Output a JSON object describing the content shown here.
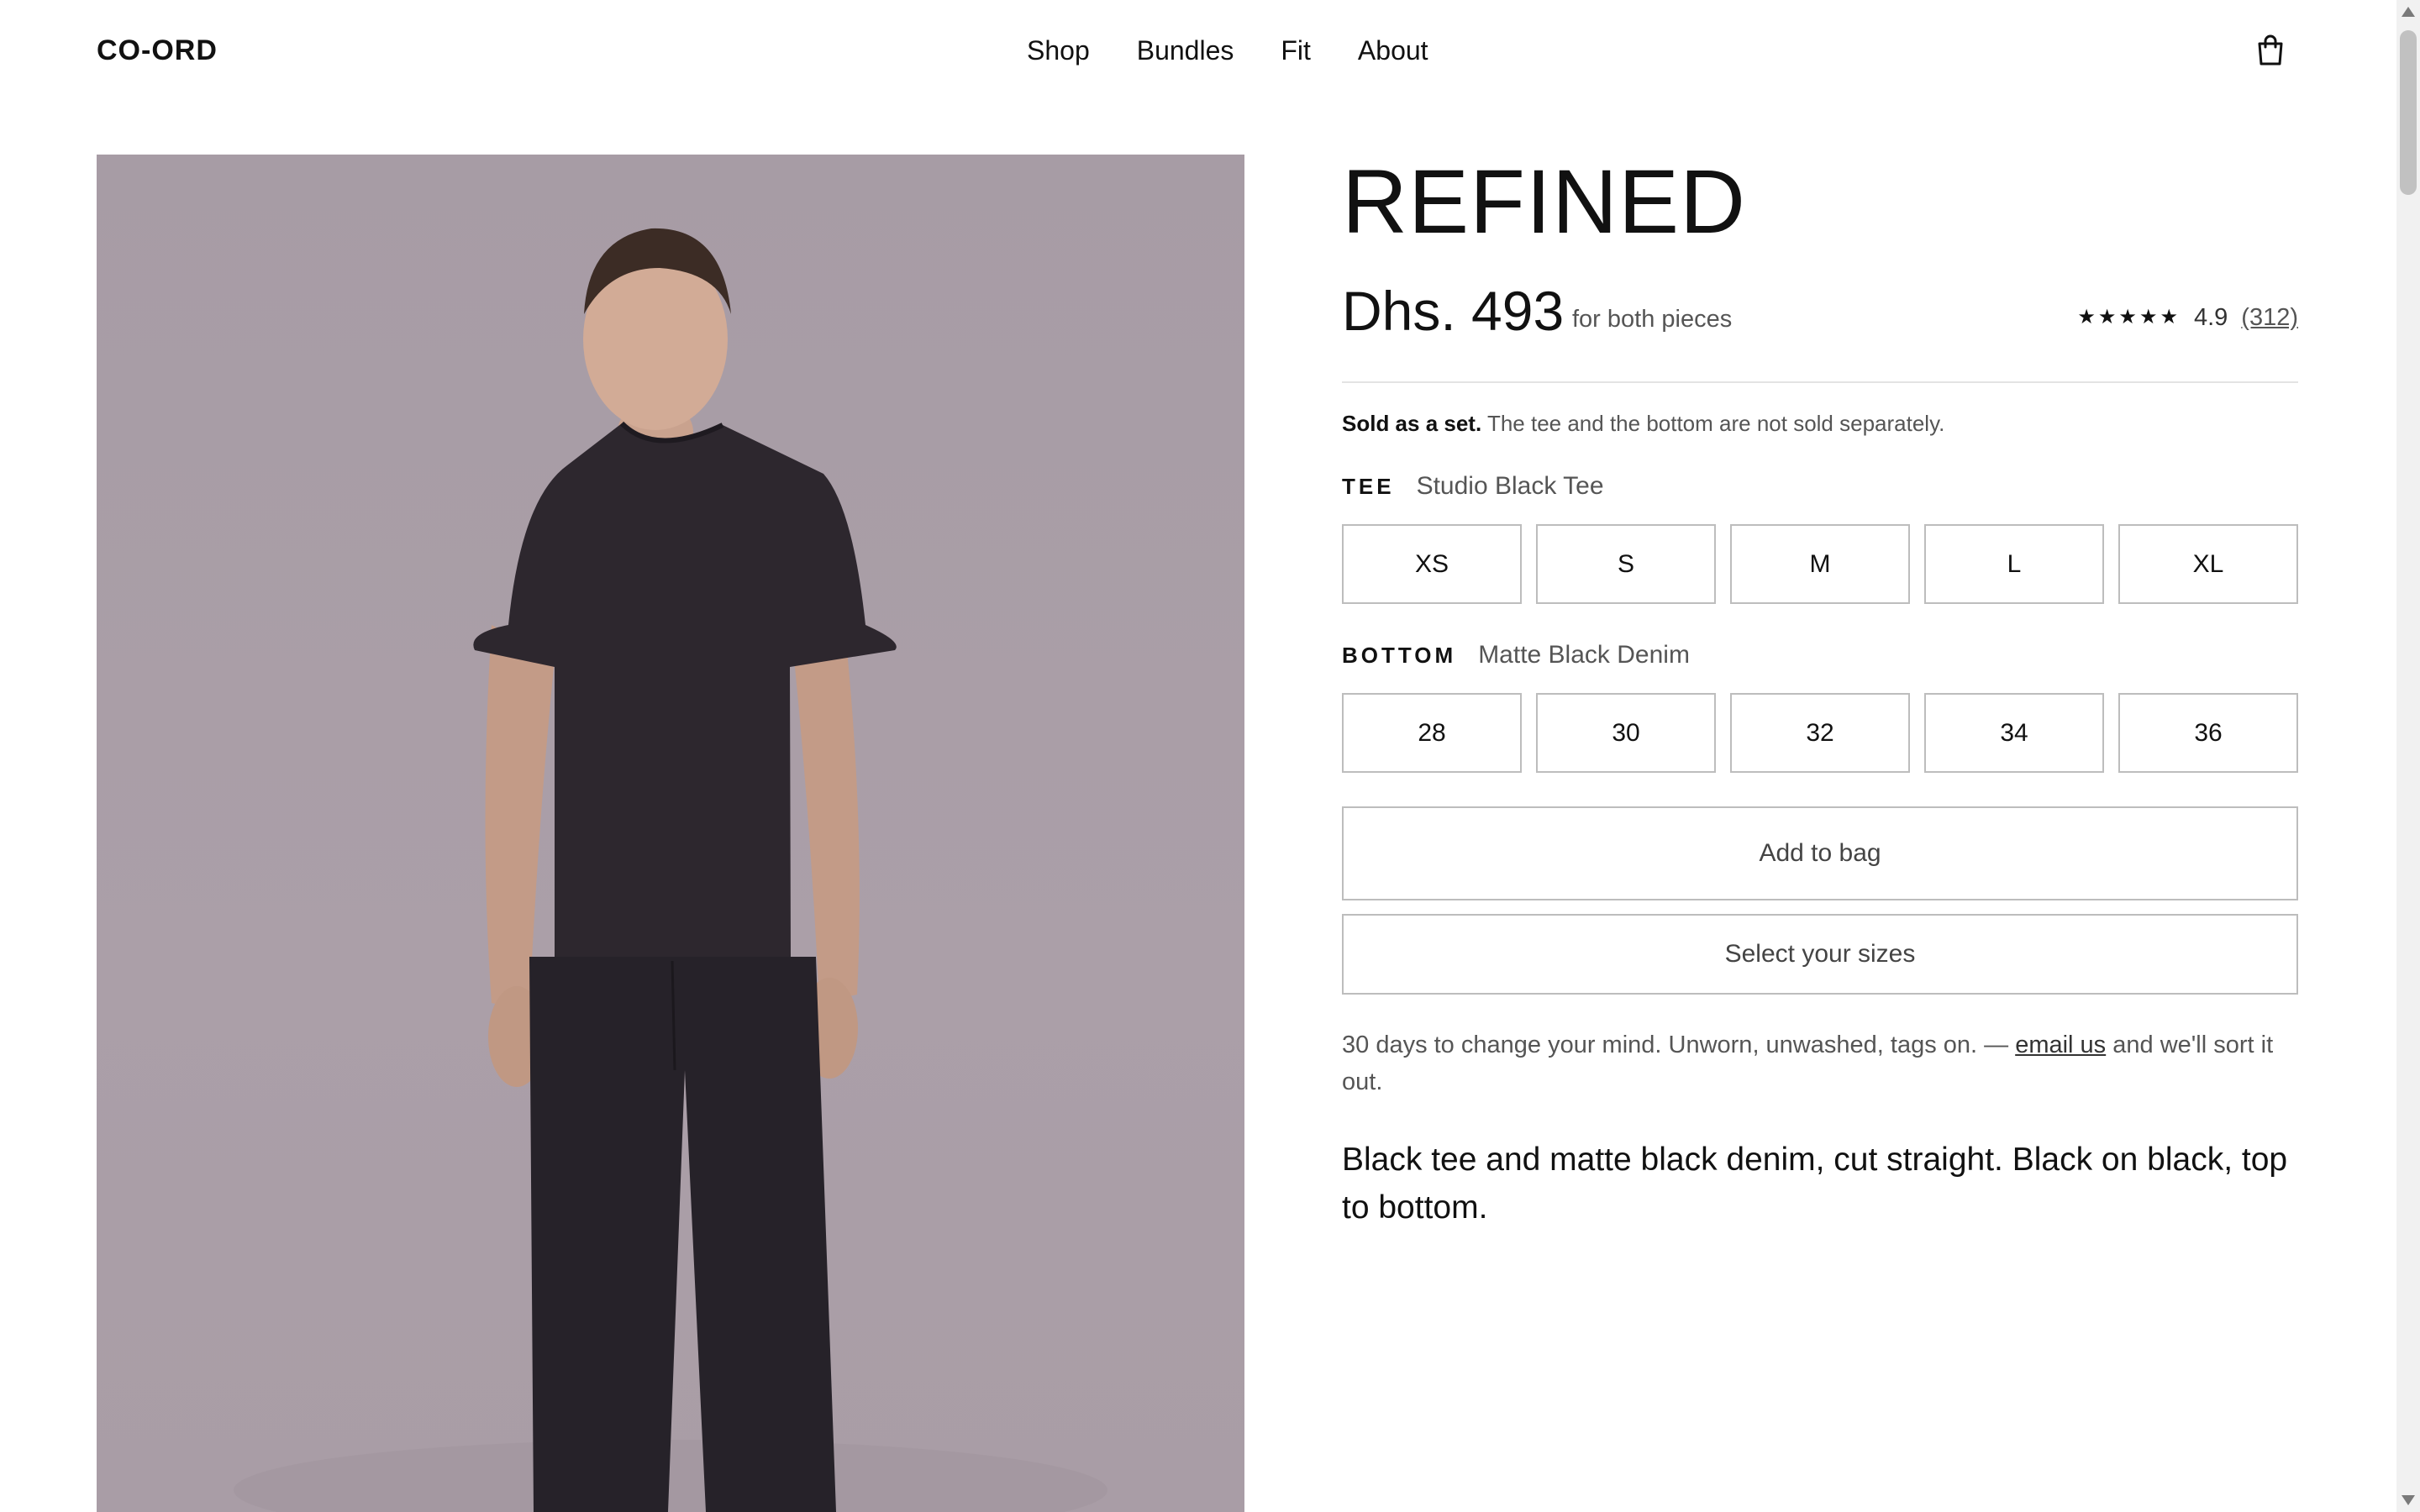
{
  "header": {
    "logo": "CO-ORD",
    "nav": [
      "Shop",
      "Bundles",
      "Fit",
      "About"
    ],
    "cart_icon": "shopping-bag-icon"
  },
  "product": {
    "title": "REFINED",
    "price": "Dhs. 493",
    "price_note": "for both pieces",
    "rating": {
      "stars": "★★★★★",
      "value": "4.9",
      "count": "(312)"
    },
    "set_note_bold": "Sold as a set.",
    "set_note_text": "The tee and the bottom are not sold separately.",
    "tee": {
      "label": "TEE",
      "name": "Studio Black Tee",
      "sizes": [
        "XS",
        "S",
        "M",
        "L",
        "XL"
      ]
    },
    "bottom": {
      "label": "BOTTOM",
      "name": "Matte Black Denim",
      "sizes": [
        "28",
        "30",
        "32",
        "34",
        "36"
      ]
    },
    "add_to_bag": "Add to bag",
    "select_sizes": "Select your sizes",
    "returns_text": "30 days to change your mind. Unworn, unwashed, tags on. —",
    "returns_link": "email us",
    "returns_tail": "and we'll sort it out.",
    "description": "Black tee and matte black denim, cut straight. Black on black, top to bottom."
  },
  "colors": {
    "image_background": "#ab9fa8",
    "garment": "#2a252b",
    "border": "#bdbdbd"
  }
}
